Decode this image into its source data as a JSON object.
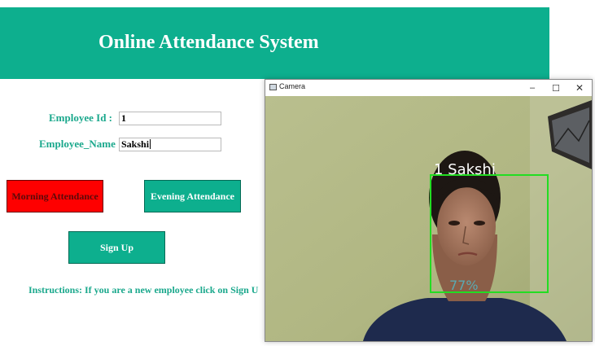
{
  "app": {
    "title": "Online Attendance System",
    "header_color": "#0daf8e"
  },
  "form": {
    "employee_id_label": "Employee Id :",
    "employee_id_value": "1",
    "employee_name_label": "Employee_Name :",
    "employee_name_value": "Sakshi"
  },
  "buttons": {
    "morning": "Morning Attendance",
    "evening": "Evening Attendance",
    "signup": "Sign Up",
    "morning_color": "#fe0000",
    "accent_color": "#0daf8e"
  },
  "instructions": "Instructions: If you are a new employee click on Sign U",
  "camera_window": {
    "title": "Camera",
    "controls": {
      "minimize": "–",
      "maximize": "☐",
      "close": "✕"
    },
    "overlay_label": "1 Sakshi",
    "confidence": "77%",
    "box_color": "#22dd22"
  }
}
